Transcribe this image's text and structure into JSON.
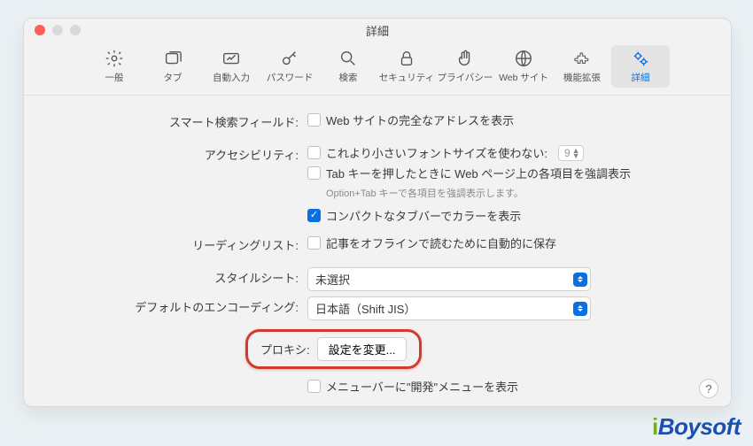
{
  "window": {
    "title": "詳細"
  },
  "toolbar": {
    "items": [
      {
        "label": "一般"
      },
      {
        "label": "タブ"
      },
      {
        "label": "自動入力"
      },
      {
        "label": "パスワード"
      },
      {
        "label": "検索"
      },
      {
        "label": "セキュリティ"
      },
      {
        "label": "プライバシー"
      },
      {
        "label": "Web サイト"
      },
      {
        "label": "機能拡張"
      },
      {
        "label": "詳細"
      }
    ]
  },
  "labels": {
    "smart_search": "スマート検索フィールド:",
    "accessibility": "アクセシビリティ:",
    "reading_list": "リーディングリスト:",
    "stylesheet": "スタイルシート:",
    "encoding": "デフォルトのエンコーディング:",
    "proxy": "プロキシ:"
  },
  "checkboxes": {
    "full_address": "Web サイトの完全なアドレスを表示",
    "min_font": "これより小さいフォントサイズを使わない:",
    "tab_highlight": "Tab キーを押したときに Web ページ上の各項目を強調表示",
    "tab_hint": "Option+Tab キーで各項目を強調表示します。",
    "compact_color": "コンパクトなタブバーでカラーを表示",
    "offline_save": "記事をオフラインで読むために自動的に保存",
    "dev_menu": "メニューバーに\"開発\"メニューを表示"
  },
  "values": {
    "font_size": "9",
    "stylesheet": "未選択",
    "encoding": "日本語（Shift JIS）",
    "proxy_button": "設定を変更..."
  },
  "help": "?",
  "watermark": {
    "i": "i",
    "brand": "Boysoft"
  }
}
